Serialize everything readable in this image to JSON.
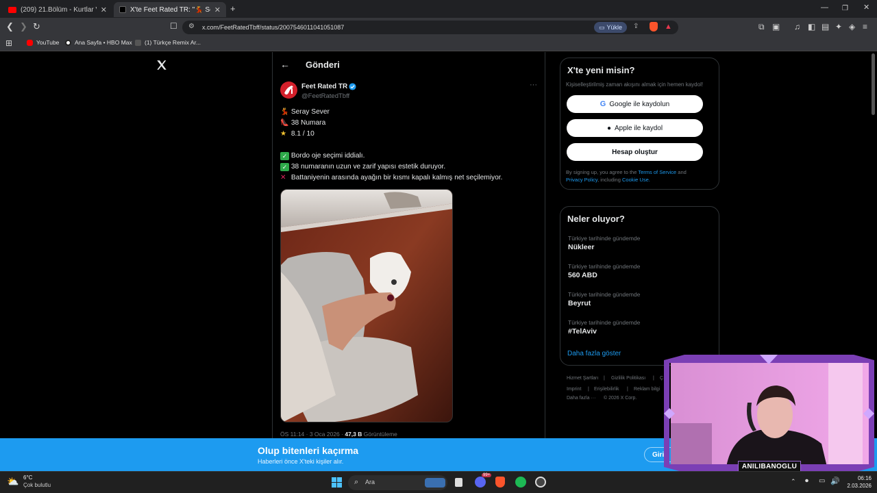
{
  "tabs": [
    {
      "title": "(209) 21.Bölüm - Kurtlar Vadisi | 4K - ",
      "active": false
    },
    {
      "title": "X'te Feet Rated TR: \"💃 Seray Se",
      "active": true
    }
  ],
  "toolbar": {
    "url": "x.com/FeetRatedTbff/status/2007546011041051087",
    "upload_label": "Yükle"
  },
  "bookmarks": [
    "YouTube",
    "Ana Sayfa • HBO Max",
    "(1) Türkçe Remix Ar..."
  ],
  "header": {
    "title": "Gönderi"
  },
  "tweet": {
    "display_name": "Feet Rated TR",
    "handle": "@FeetRatedTbff",
    "lines": [
      "Seray Sever",
      "38 Numara",
      "8.1 / 10",
      "Bordo oje seçimi iddialı.",
      "38 numaranın uzun ve zarif yapısı estetik duruyor.",
      "Battaniyenin arasında ayağın bir kısmı kapalı kalmış net seçilemiyor."
    ],
    "time": "ÖS 11:14 · 3 Oca 2026 · ",
    "views_count": "47,3 B",
    "views_label": "Görüntüleme"
  },
  "signup": {
    "title": "X'te yeni misin?",
    "subtitle": "Kişiselleştirilmiş zaman akışını almak için hemen kaydol!",
    "google_btn": "Google ile kaydolun",
    "apple_btn": "Apple ile kaydol",
    "create_btn": "Hesap oluştur",
    "legal_1": "By signing up, you agree to the ",
    "tos": "Terms of Service",
    "and": " and",
    "privacy": "Privacy Policy",
    "including": ", including ",
    "cookie": "Cookie Use."
  },
  "trends": {
    "title": "Neler oluyor?",
    "items": [
      {
        "category": "Türkiye tarihinde gündemde",
        "name": "Nükleer"
      },
      {
        "category": "Türkiye tarihinde gündemde",
        "name": "560 ABD"
      },
      {
        "category": "Türkiye tarihinde gündemde",
        "name": "Beyrut"
      },
      {
        "category": "Türkiye tarihinde gündemde",
        "name": "#TelAviv"
      }
    ],
    "show_more": "Daha fazla göster"
  },
  "footer": {
    "row1": [
      "Hizmet Şartları",
      "|",
      "Gizlilik Politikası",
      "|",
      "Ç"
    ],
    "row2": [
      "Imprint",
      "|",
      "Erişilebilirlik",
      "|",
      "Reklam bilgi"
    ],
    "row3": [
      "Daha fazla ···",
      "© 2026 X Corp."
    ]
  },
  "banner": {
    "title": "Olup bitenleri kaçırma",
    "subtitle": "Haberleri önce X'teki kişiler alır.",
    "login_btn": "Giriş"
  },
  "taskbar": {
    "temp": "6°C",
    "weather": "Çok bulutlu",
    "search_placeholder": "Ara",
    "time": "06:16",
    "date": "2.03.2026",
    "badge": "99+"
  },
  "stream": {
    "name": "ANILIBANOGLU"
  },
  "colors": {
    "accent": "#1d9bf0",
    "banner": "#1d9bf0",
    "overlay": "#7b3fb5"
  }
}
